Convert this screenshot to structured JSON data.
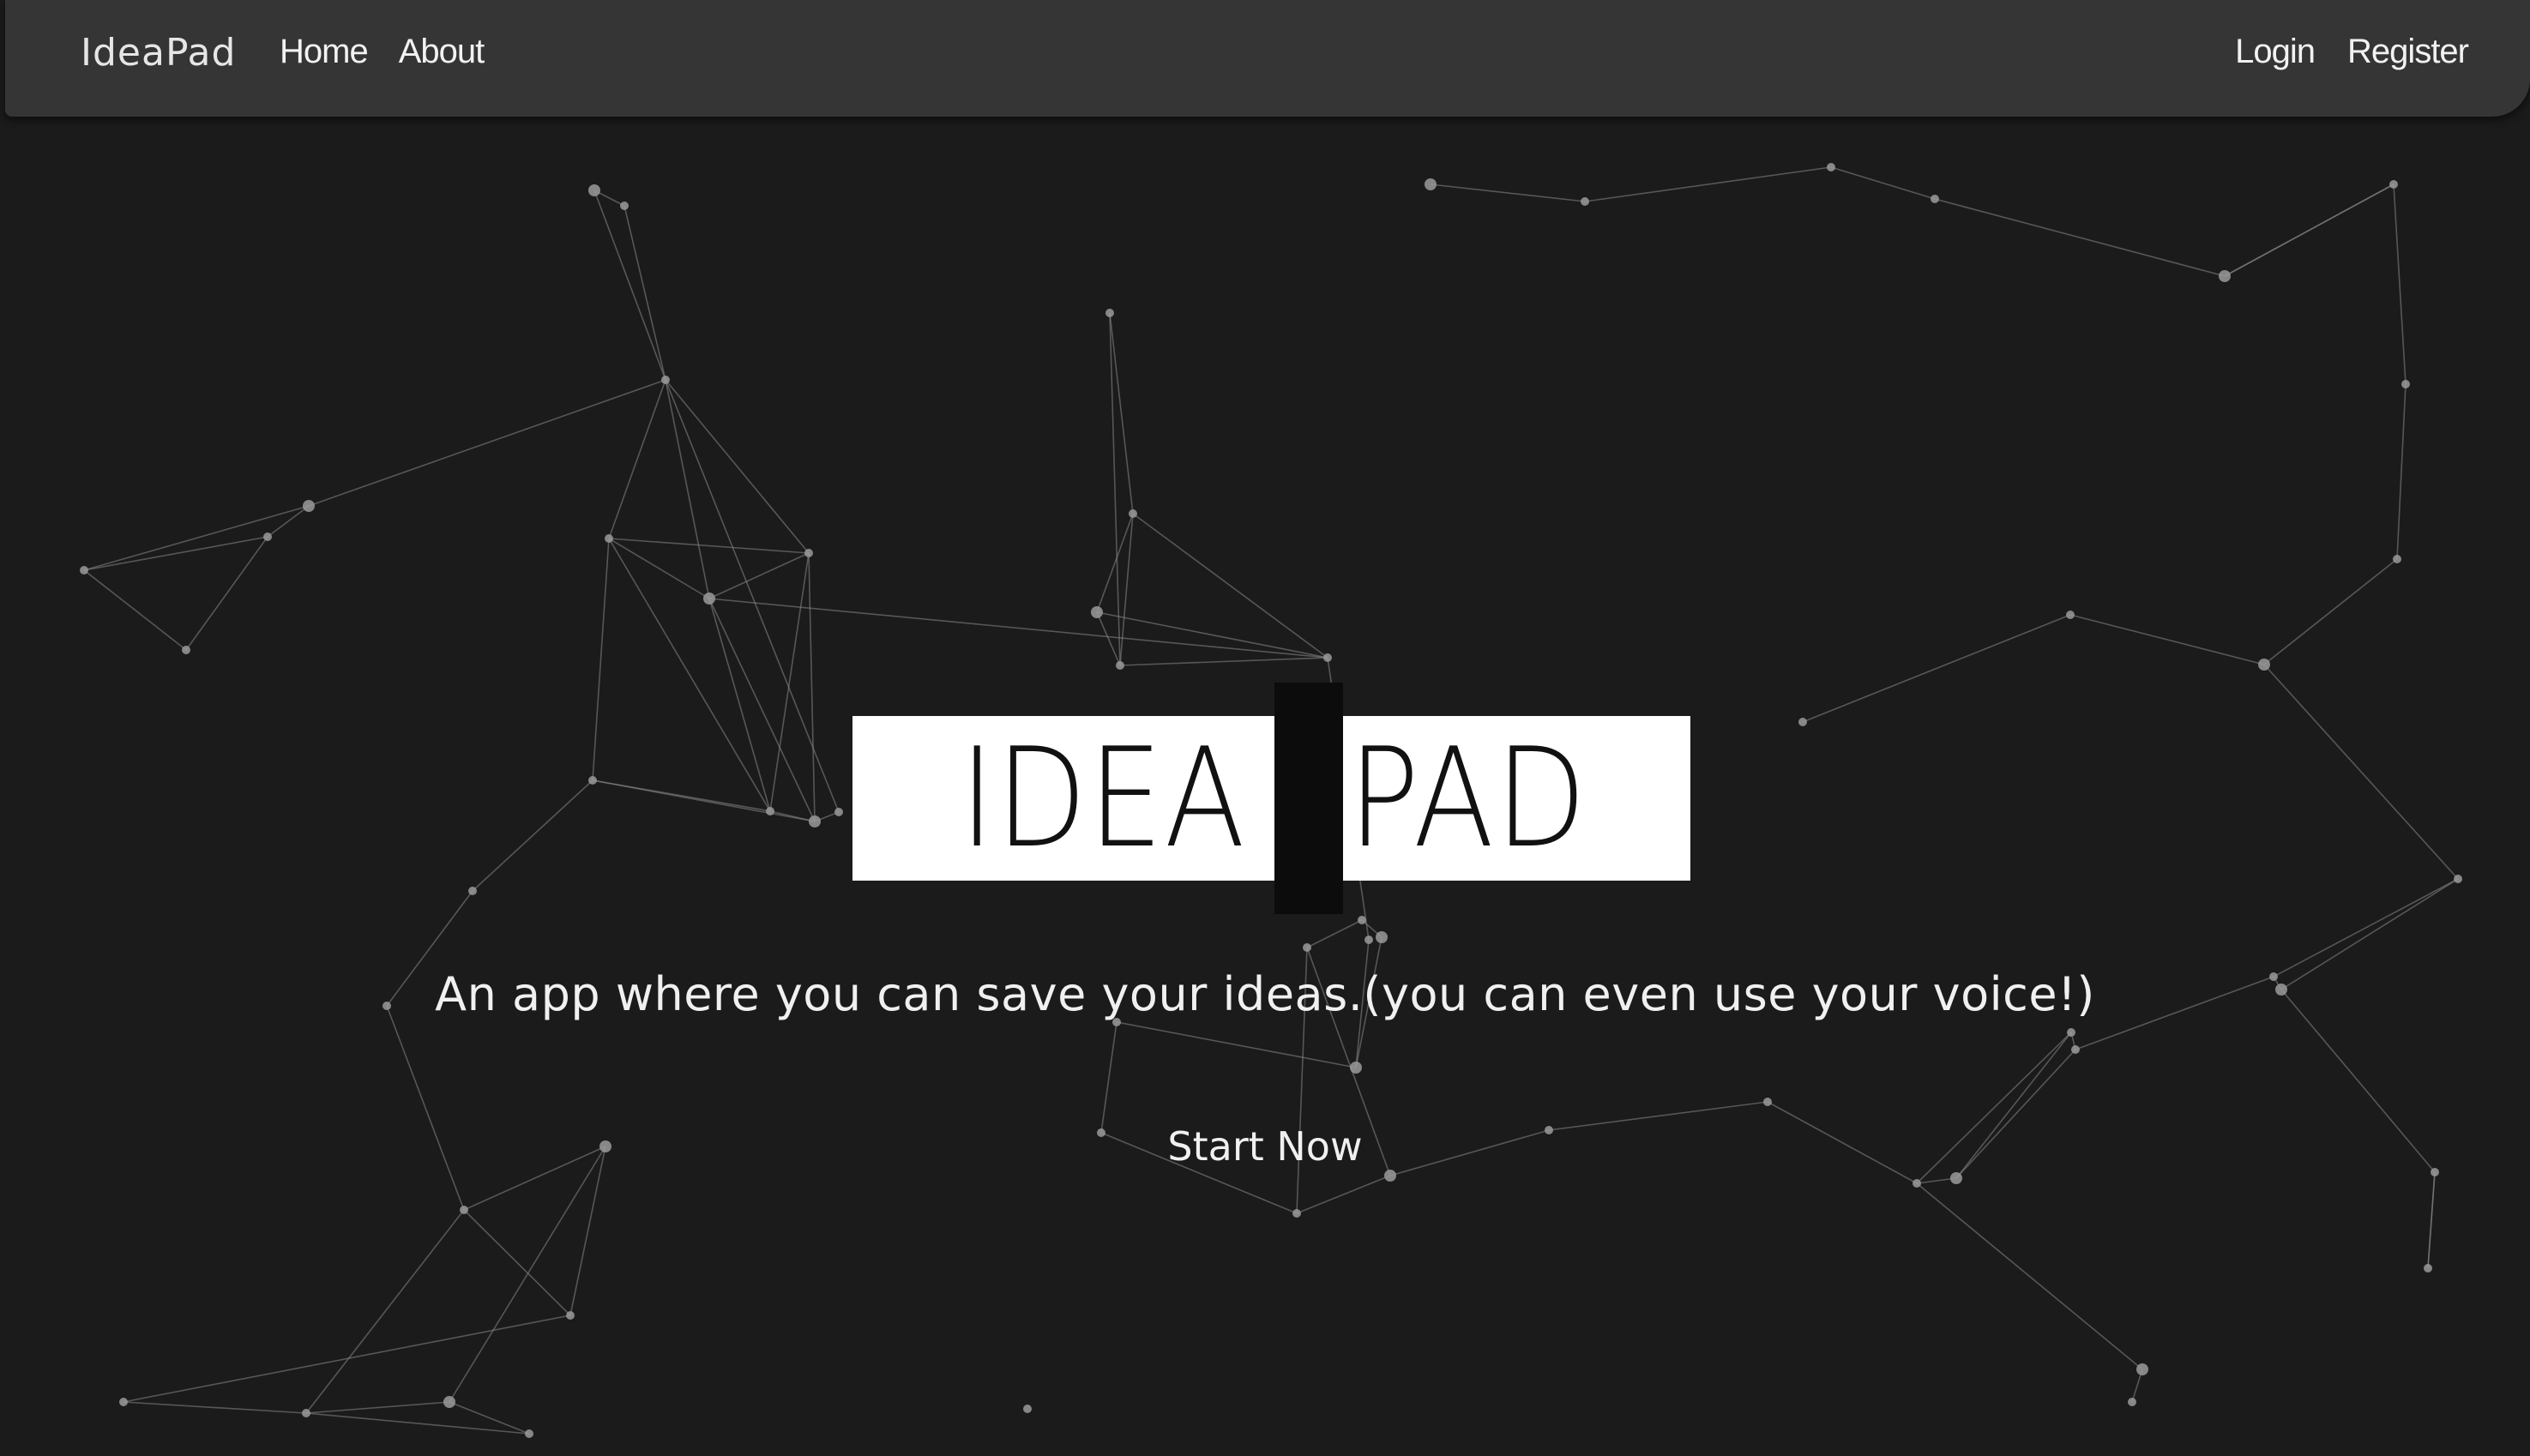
{
  "navbar": {
    "brand": "IdeaPad",
    "left_links": [
      "Home",
      "About"
    ],
    "right_links": [
      "Login",
      "Register"
    ]
  },
  "hero": {
    "title_left": "IDEA",
    "title_right": "PAD",
    "tagline": "An app where you can save your ideas.(you can even use your voice!)",
    "cta": "Start Now"
  },
  "colors": {
    "background": "#1b1b1b",
    "navbar": "#353535",
    "particles": "#888888",
    "title_box": "#ffffff",
    "title_text": "#111111"
  }
}
